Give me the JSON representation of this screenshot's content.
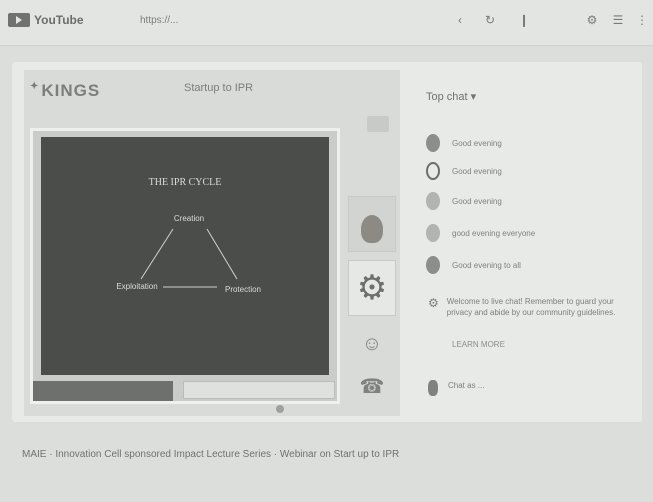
{
  "browser": {
    "logo_text": "YouTube",
    "url": "https://...",
    "icons": [
      "share-icon",
      "refresh-icon",
      "mic-icon",
      "settings-icon",
      "menu-icon",
      "more-icon"
    ]
  },
  "player": {
    "brand": "KINGS",
    "title": "Startup to IPR",
    "slide": {
      "heading": "THE IPR CYCLE",
      "top_node": "Creation",
      "left_node": "Exploitation",
      "right_node": "Protection"
    },
    "footer": "",
    "thumbs": [
      "person-thumbnail",
      "gear-icon",
      "tool-icon",
      "tool-icon-2"
    ]
  },
  "chat": {
    "title": "Top chat",
    "messages": [
      {
        "name": "",
        "text": "Good evening"
      },
      {
        "name": "",
        "text": "Good evening"
      },
      {
        "name": "",
        "text": "Good evening"
      },
      {
        "name": "",
        "text": "good evening everyone"
      },
      {
        "name": "",
        "text": "Good evening to all"
      }
    ],
    "info": "Welcome to live chat! Remember to guard your privacy and abide by our community guidelines.",
    "learn_more": "LEARN MORE",
    "input_hint": "Chat as ..."
  },
  "caption": "MAIE · Innovation Cell sponsored Impact Lecture Series · Webinar on Start up to IPR"
}
